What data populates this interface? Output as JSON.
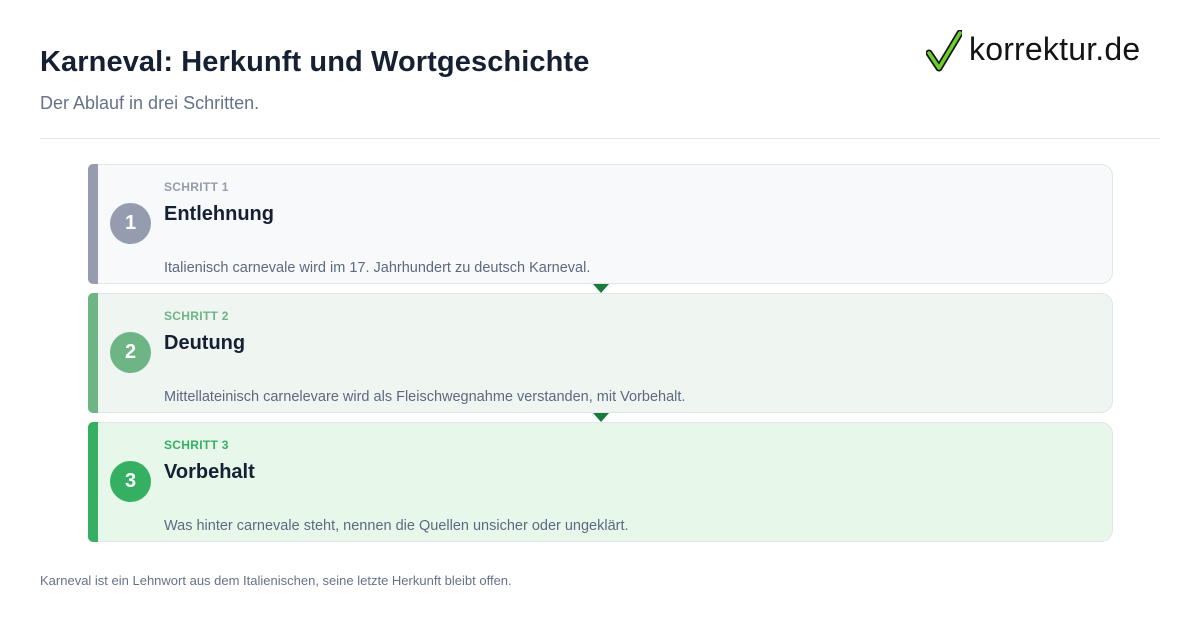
{
  "header": {
    "title": "Karneval: Herkunft und Wortgeschichte",
    "subtitle": "Der Ablauf in drei Schritten."
  },
  "logo": {
    "text": "korrektur.de",
    "icon": "checkmark-icon",
    "check_color": "#6ad02a"
  },
  "steps": [
    {
      "number": "1",
      "kicker": "Schritt 1",
      "title": "Entlehnung",
      "description": "Italienisch carnevale wird im 17. Jahrhundert zu deutsch Karneval.",
      "accent": "#959cb0",
      "kicker_color": "#959cb0",
      "background": "#f8f9fb"
    },
    {
      "number": "2",
      "kicker": "Schritt 2",
      "title": "Deutung",
      "description": "Mittellateinisch carnelevare wird als Fleischwegnahme verstanden, mit Vorbehalt.",
      "accent": "#6db585",
      "kicker_color": "#6db585",
      "background": "#eff5f1"
    },
    {
      "number": "3",
      "kicker": "Schritt 3",
      "title": "Vorbehalt",
      "description": "Was hinter carnevale steht, nennen die Quellen unsicher oder ungeklärt.",
      "accent": "#35b063",
      "kicker_color": "#35b063",
      "background": "#e7f8eb"
    }
  ],
  "connector_color": "#1a7a3c",
  "footnote": "Karneval ist ein Lehnwort aus dem Italienischen, seine letzte Herkunft bleibt offen."
}
